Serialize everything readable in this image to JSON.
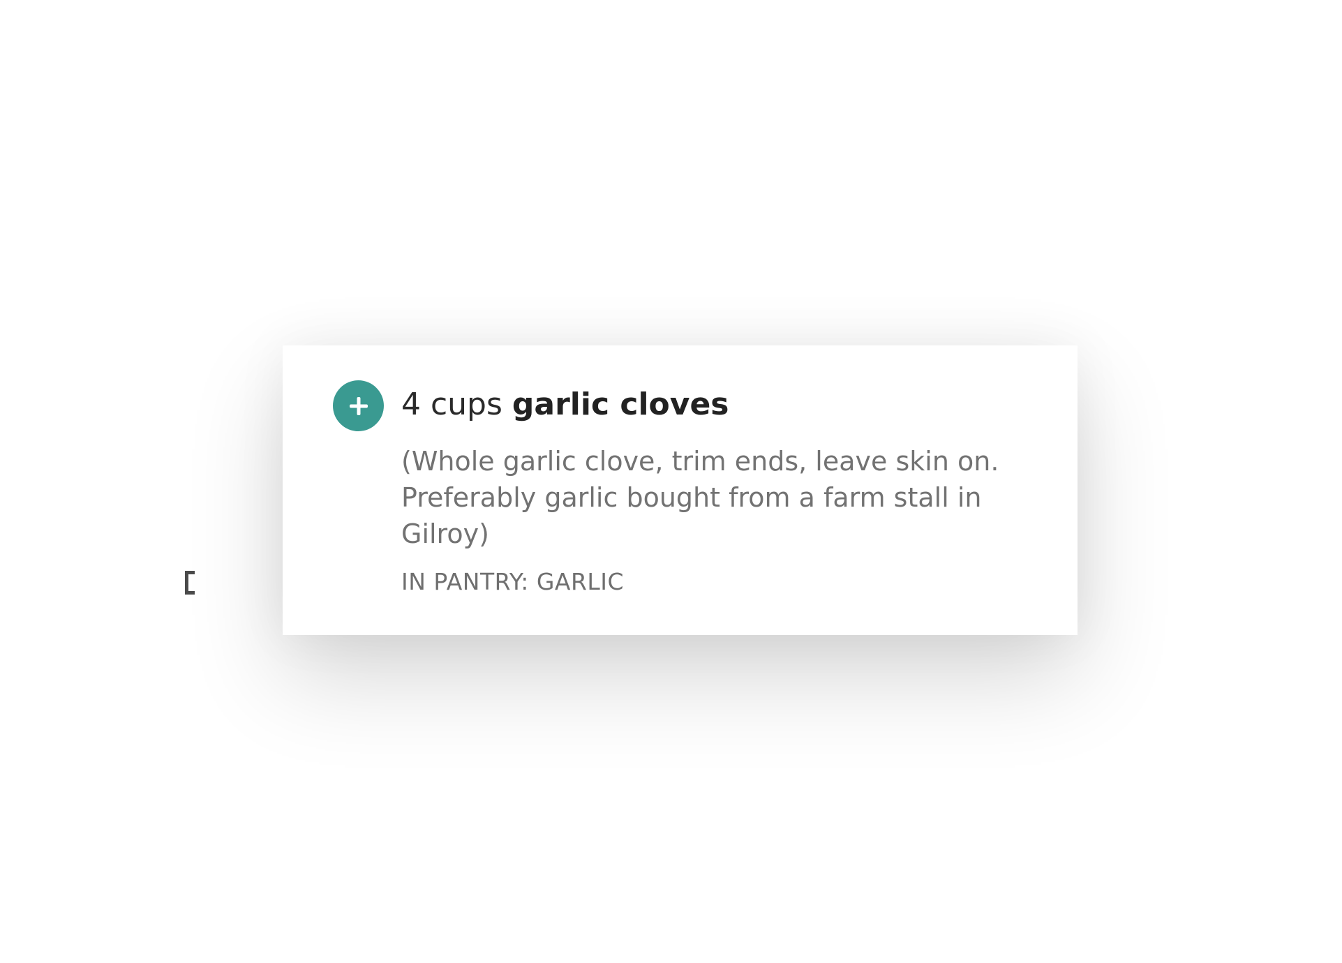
{
  "ingredient": {
    "quantity": "4 cups",
    "name": "garlic cloves",
    "note": "(Whole garlic clove, trim ends, leave skin on. Preferably garlic bought from a farm stall in Gilroy)",
    "pantry_status": "IN PANTRY: GARLIC"
  },
  "add_button": {
    "icon": "plus-icon"
  },
  "colors": {
    "accent": "#3a9a91",
    "primary_text": "#222222",
    "secondary_text": "#727272"
  }
}
